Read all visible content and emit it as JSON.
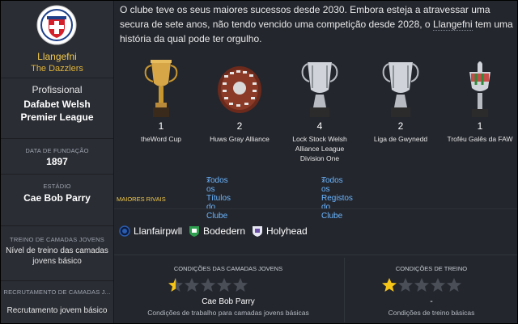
{
  "club": {
    "name": "Llangefni",
    "nickname": "The Dazzlers",
    "status": "Profissional",
    "league_line1": "Dafabet Welsh",
    "league_line2": "Premier League",
    "founded_label": "DATA DE FUNDAÇÃO",
    "founded_value": "1897",
    "stadium_label": "ESTÁDIO",
    "stadium_value": "Cae Bob Parry",
    "youth_training_label": "TREINO DE CAMADAS JOVENS",
    "youth_training_line1": "Nível de treino das camadas",
    "youth_training_line2": "jovens básico",
    "youth_recruit_label": "RECRUTAMENTO DE CAMADAS J...",
    "youth_recruit_value": "Recrutamento jovem básico"
  },
  "intro": {
    "text_before": "O clube teve os seus maiores sucessos desde 2030. Embora esteja a atravessar uma secura de sete anos, não tendo vencido uma competição desde 2028, o ",
    "club_link": "Llangefni",
    "text_after": " tem uma história da qual pode ter orgulho."
  },
  "trophies": [
    {
      "count": "1",
      "name_line1": "theWord Cup",
      "name_line2": "",
      "name_line3": "",
      "icon": "cup-trophy-icon"
    },
    {
      "count": "2",
      "name_line1": "Huws Gray Alliance",
      "name_line2": "",
      "name_line3": "",
      "icon": "shield-trophy-icon"
    },
    {
      "count": "4",
      "name_line1": "Lock Stock Welsh",
      "name_line2": "Alliance League",
      "name_line3": "Division One",
      "icon": "silver-trophy-icon"
    },
    {
      "count": "2",
      "name_line1": "Liga de Gwynedd",
      "name_line2": "",
      "name_line3": "",
      "icon": "silver-trophy-icon"
    },
    {
      "count": "1",
      "name_line1": "Troféu Galês da FAW",
      "name_line2": "",
      "name_line3": "",
      "icon": "ribbon-cup-icon"
    }
  ],
  "links": {
    "all_titles": "Todos os Títulos do Clube",
    "all_records": "Todos os Registos do Clube"
  },
  "rivals": {
    "label": "MAIORES RIVAIS",
    "items": [
      {
        "name": "Llanfairpwll",
        "icon": "llanfairpwll-badge-icon",
        "color": "#2a5db0"
      },
      {
        "name": "Bodedern",
        "icon": "bodedern-badge-icon",
        "color": "#2e9e4f"
      },
      {
        "name": "Holyhead",
        "icon": "holyhead-badge-icon",
        "color": "#6b4fa8"
      }
    ]
  },
  "youth_facilities": {
    "title": "CONDIÇÕES DAS CAMADAS JOVENS",
    "rating": 0.5,
    "max_rating": 5,
    "value": "Cae Bob Parry",
    "description": "Condições de trabalho para camadas jovens básicas"
  },
  "training_facilities": {
    "title": "CONDIÇÕES DE TREINO",
    "rating": 1,
    "max_rating": 5,
    "value": "-",
    "description": "Condições de treino básicas"
  },
  "colors": {
    "accent_gold": "#f2c94c",
    "link_blue": "#6cb6ff",
    "star_filled": "#f5c518",
    "star_empty": "#4a4e57"
  }
}
